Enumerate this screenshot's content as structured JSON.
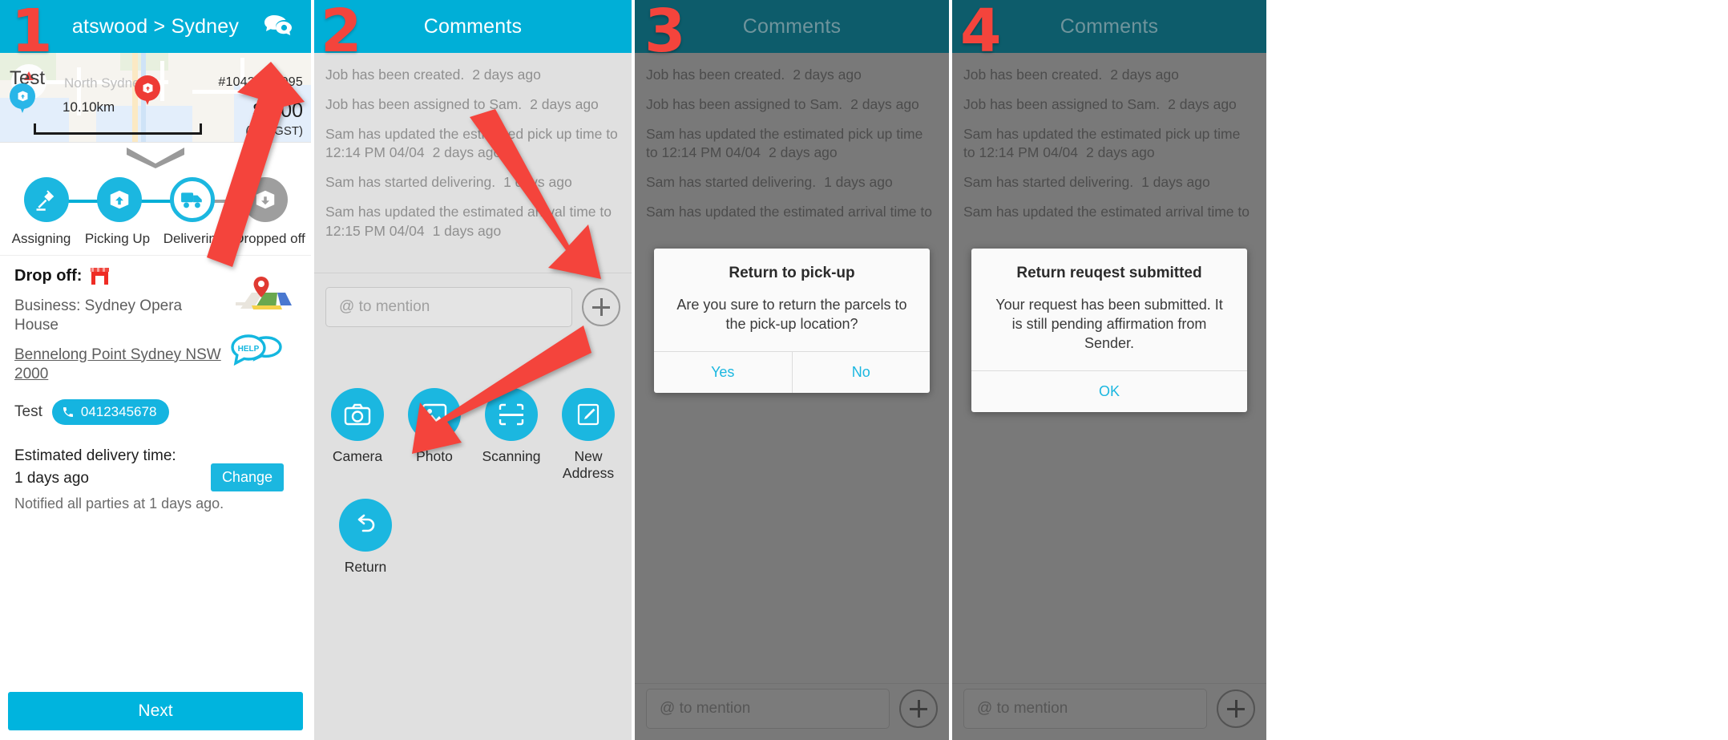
{
  "annotations": {
    "numbers": [
      "1",
      "2",
      "3",
      "4"
    ]
  },
  "panel1": {
    "header": {
      "title": "atswood > Sydney",
      "chat_icon": "comments-icon"
    },
    "map": {
      "test_label": "Test",
      "city_label": "North Sydney",
      "distance": "10.10km",
      "pickup_pin": "package-pin-blue",
      "dropoff_pin": "package-pin-red"
    },
    "job": {
      "order_number": "#10427€-7995",
      "amount": "$1.00",
      "gst_note": "(incl. GST)"
    },
    "steps": [
      {
        "label": "Assigning",
        "icon": "gavel-icon",
        "state": "done"
      },
      {
        "label": "Picking Up",
        "icon": "package-up-icon",
        "state": "done"
      },
      {
        "label": "Delivering",
        "icon": "truck-icon",
        "state": "current"
      },
      {
        "label": "Dropped off",
        "icon": "package-down-icon",
        "state": "pending"
      }
    ],
    "details": {
      "dropoff_label": "Drop off:",
      "shop_icon": "storefront-icon",
      "business": "Business: Sydney Opera House",
      "address": "Bennelong Point Sydney NSW 2000",
      "contact_name": "Test",
      "phone": "0412345678",
      "map_icon": "google-maps-icon",
      "help_icon": "help-bubbles-icon",
      "eta_label": "Estimated delivery time:",
      "eta_value": "1 days ago",
      "notified": "Notified all parties at 1 days ago.",
      "change_button": "Change"
    },
    "next_button": "Next"
  },
  "panel2": {
    "header": {
      "title": "Comments"
    },
    "comments": [
      {
        "text": "Job has been created.",
        "ago": "2 days ago"
      },
      {
        "text": "Job has been assigned to Sam.",
        "ago": "2 days ago"
      },
      {
        "text": "Sam has updated the estimated pick up time to 12:14 PM 04/04",
        "ago": "2 days ago"
      },
      {
        "text": "Sam has started delivering.",
        "ago": "1 days ago"
      },
      {
        "text": "Sam has updated the estimated arrival time to 12:15 PM 04/04",
        "ago": "1 days ago"
      }
    ],
    "input": {
      "placeholder": "@ to mention",
      "add_button": "plus-icon"
    },
    "actions": [
      {
        "label": "Camera",
        "icon": "camera-icon"
      },
      {
        "label": "Photo",
        "icon": "photo-icon"
      },
      {
        "label": "Scanning",
        "icon": "scan-icon"
      },
      {
        "label": "New Address",
        "icon": "pencil-edit-icon"
      },
      {
        "label": "Return",
        "icon": "return-arrow-icon"
      }
    ]
  },
  "panel3": {
    "header": {
      "title": "Comments"
    },
    "comments": [
      {
        "text": "Job has been created.",
        "ago": "2 days ago"
      },
      {
        "text": "Job has been assigned to Sam.",
        "ago": "2 days ago"
      },
      {
        "text": "Sam has updated the estimated pick up time to 12:14 PM 04/04",
        "ago": "2 days ago"
      },
      {
        "text": "Sam has started delivering.",
        "ago": "1 days ago"
      },
      {
        "text": "Sam has updated the estimated arrival time to",
        "ago": ""
      }
    ],
    "dialog": {
      "title": "Return to pick-up",
      "message": "Are you sure to return the parcels to the pick-up location?",
      "buttons": [
        "Yes",
        "No"
      ]
    },
    "input": {
      "placeholder": "@ to mention",
      "add_button": "plus-icon"
    }
  },
  "panel4": {
    "header": {
      "title": "Comments"
    },
    "comments": [
      {
        "text": "Job has been created.",
        "ago": "2 days ago"
      },
      {
        "text": "Job has been assigned to Sam.",
        "ago": "2 days ago"
      },
      {
        "text": "Sam has updated the estimated pick up time to 12:14 PM 04/04",
        "ago": "2 days ago"
      },
      {
        "text": "Sam has started delivering.",
        "ago": "1 days ago"
      },
      {
        "text": "Sam has updated the estimated arrival time to",
        "ago": ""
      }
    ],
    "dialog": {
      "title": "Return reuqest submitted",
      "message": "Your request has been submitted. It is still pending affirmation from Sender.",
      "buttons": [
        "OK"
      ]
    },
    "input": {
      "placeholder": "@ to mention",
      "add_button": "plus-icon"
    }
  },
  "colors": {
    "accent": "#00AFD7",
    "accent_light": "#1BB7E0",
    "annotation_red": "#F4443C",
    "dim_header": "#0D5C6B"
  }
}
